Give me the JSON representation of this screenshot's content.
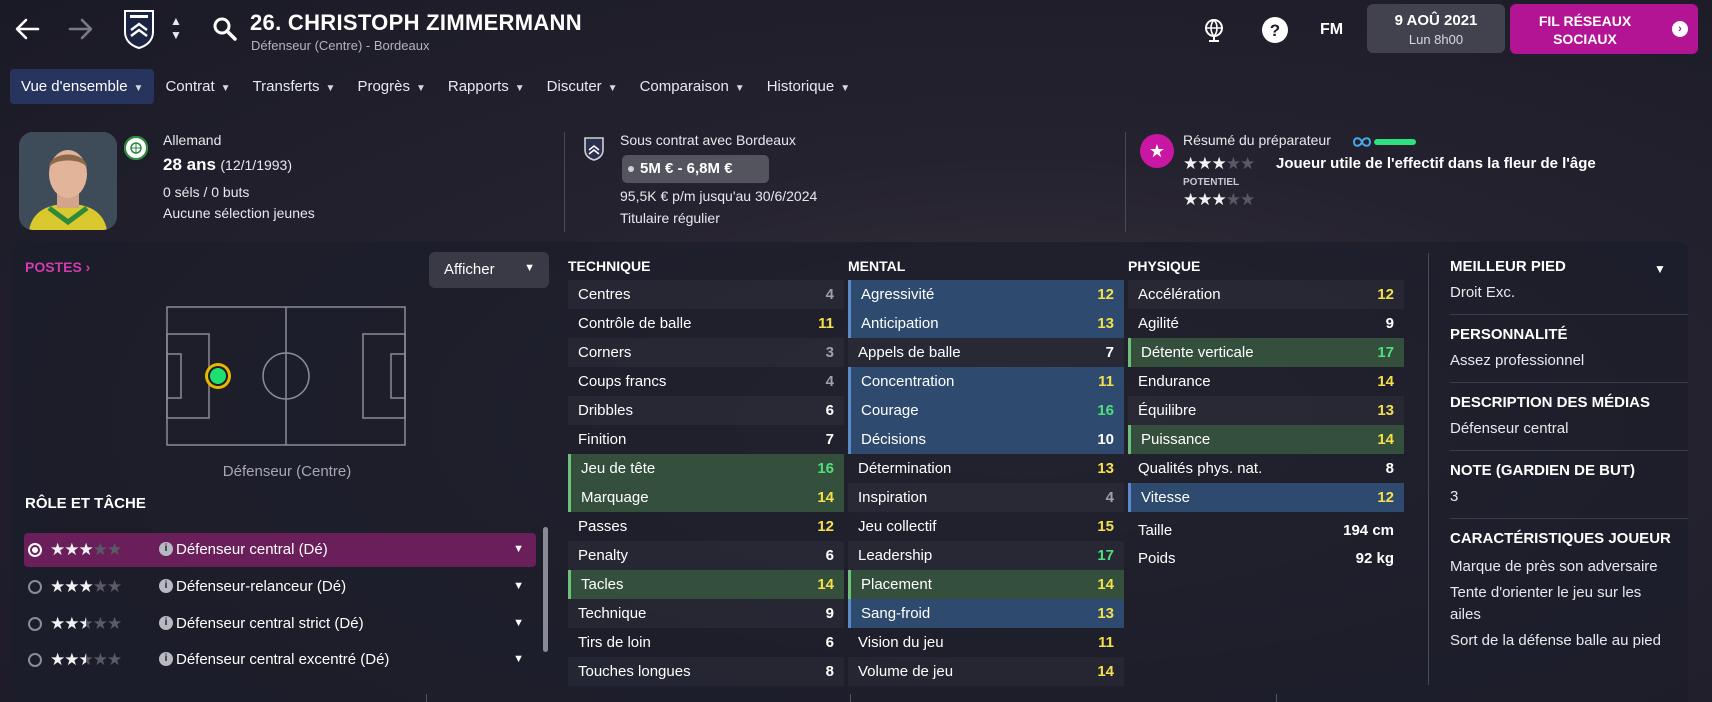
{
  "topbar": {
    "title": "26. CHRISTOPH ZIMMERMANN",
    "subtitle": "Défenseur (Centre) - Bordeaux",
    "fm_logo": "FM",
    "date_line1": "9 AOÛ 2021",
    "date_line2": "Lun 8h00",
    "social_label": "FIL RÉSEAUX SOCIAUX"
  },
  "tabs": [
    {
      "label": "Vue d'ensemble"
    },
    {
      "label": "Contrat"
    },
    {
      "label": "Transferts"
    },
    {
      "label": "Progrès"
    },
    {
      "label": "Rapports"
    },
    {
      "label": "Discuter"
    },
    {
      "label": "Comparaison"
    },
    {
      "label": "Historique"
    }
  ],
  "profile": {
    "nationality": "Allemand",
    "age": "28 ans",
    "dob": "(12/1/1993)",
    "caps": "0 séls / 0 buts",
    "youth": "Aucune sélection jeunes"
  },
  "contract": {
    "club": "Sous contrat avec Bordeaux",
    "value": "5M € - 6,8M €",
    "wage": "95,5K € p/m jusqu'au 30/6/2024",
    "status": "Titulaire régulier"
  },
  "scout": {
    "title": "Résumé du préparateur",
    "current_stars": 3,
    "verdict": "Joueur utile de l'effectif dans la fleur de l'âge",
    "potential_label": "POTENTIEL",
    "potential_stars": 3
  },
  "positions": {
    "title": "POSTES",
    "show_button": "Afficher",
    "label": "Défenseur (Centre)"
  },
  "roles": {
    "title": "RÔLE ET TÂCHE",
    "items": [
      {
        "name": "Défenseur central (Dé)",
        "stars": 3,
        "selected": true
      },
      {
        "name": "Défenseur-relanceur (Dé)",
        "stars": 3,
        "selected": false
      },
      {
        "name": "Défenseur central strict (Dé)",
        "stars": 2.5,
        "selected": false
      },
      {
        "name": "Défenseur central excentré (Dé)",
        "stars": 2.5,
        "selected": false
      }
    ]
  },
  "technique": {
    "title": "TECHNIQUE",
    "items": [
      {
        "name": "Centres",
        "value": "4",
        "color": "grey",
        "hl": "alt"
      },
      {
        "name": "Contrôle de balle",
        "value": "11",
        "color": "yellow",
        "hl": ""
      },
      {
        "name": "Corners",
        "value": "3",
        "color": "grey",
        "hl": "alt"
      },
      {
        "name": "Coups francs",
        "value": "4",
        "color": "grey",
        "hl": ""
      },
      {
        "name": "Dribbles",
        "value": "6",
        "color": "white",
        "hl": "alt"
      },
      {
        "name": "Finition",
        "value": "7",
        "color": "white",
        "hl": ""
      },
      {
        "name": "Jeu de tête",
        "value": "16",
        "color": "green",
        "hl": "green"
      },
      {
        "name": "Marquage",
        "value": "14",
        "color": "yellow",
        "hl": "green"
      },
      {
        "name": "Passes",
        "value": "12",
        "color": "yellow",
        "hl": ""
      },
      {
        "name": "Penalty",
        "value": "6",
        "color": "white",
        "hl": "alt"
      },
      {
        "name": "Tacles",
        "value": "14",
        "color": "yellow",
        "hl": "green"
      },
      {
        "name": "Technique",
        "value": "9",
        "color": "white",
        "hl": "alt"
      },
      {
        "name": "Tirs de loin",
        "value": "6",
        "color": "white",
        "hl": ""
      },
      {
        "name": "Touches longues",
        "value": "8",
        "color": "white",
        "hl": "alt"
      }
    ]
  },
  "mental": {
    "title": "MENTAL",
    "items": [
      {
        "name": "Agressivité",
        "value": "12",
        "color": "yellow",
        "hl": "blue"
      },
      {
        "name": "Anticipation",
        "value": "13",
        "color": "yellow",
        "hl": "blue"
      },
      {
        "name": "Appels de balle",
        "value": "7",
        "color": "white",
        "hl": "alt"
      },
      {
        "name": "Concentration",
        "value": "11",
        "color": "yellow",
        "hl": "blue"
      },
      {
        "name": "Courage",
        "value": "16",
        "color": "green",
        "hl": "blue"
      },
      {
        "name": "Décisions",
        "value": "10",
        "color": "white",
        "hl": "blue"
      },
      {
        "name": "Détermination",
        "value": "13",
        "color": "yellow",
        "hl": ""
      },
      {
        "name": "Inspiration",
        "value": "4",
        "color": "grey",
        "hl": "alt"
      },
      {
        "name": "Jeu collectif",
        "value": "15",
        "color": "yellow",
        "hl": ""
      },
      {
        "name": "Leadership",
        "value": "17",
        "color": "green",
        "hl": "alt"
      },
      {
        "name": "Placement",
        "value": "14",
        "color": "yellow",
        "hl": "green"
      },
      {
        "name": "Sang-froid",
        "value": "13",
        "color": "yellow",
        "hl": "blue"
      },
      {
        "name": "Vision du jeu",
        "value": "11",
        "color": "yellow",
        "hl": ""
      },
      {
        "name": "Volume de jeu",
        "value": "14",
        "color": "yellow",
        "hl": "alt"
      }
    ]
  },
  "physique": {
    "title": "PHYSIQUE",
    "items": [
      {
        "name": "Accélération",
        "value": "12",
        "color": "yellow",
        "hl": "alt"
      },
      {
        "name": "Agilité",
        "value": "9",
        "color": "white",
        "hl": ""
      },
      {
        "name": "Détente verticale",
        "value": "17",
        "color": "green",
        "hl": "green"
      },
      {
        "name": "Endurance",
        "value": "14",
        "color": "yellow",
        "hl": ""
      },
      {
        "name": "Équilibre",
        "value": "13",
        "color": "yellow",
        "hl": "alt"
      },
      {
        "name": "Puissance",
        "value": "14",
        "color": "yellow",
        "hl": "green"
      },
      {
        "name": "Qualités phys. nat.",
        "value": "8",
        "color": "white",
        "hl": ""
      },
      {
        "name": "Vitesse",
        "value": "12",
        "color": "yellow",
        "hl": "blue"
      }
    ],
    "height_label": "Taille",
    "height_value": "194 cm",
    "weight_label": "Poids",
    "weight_value": "92 kg"
  },
  "details": {
    "best_foot_title": "MEILLEUR PIED",
    "best_foot": "Droit Exc.",
    "personality_title": "PERSONNALITÉ",
    "personality": "Assez professionnel",
    "media_title": "DESCRIPTION DES MÉDIAS",
    "media": "Défenseur central",
    "gk_title": "NOTE (GARDIEN DE BUT)",
    "gk": "3",
    "traits_title": "CARACTÉRISTIQUES JOUEUR",
    "traits": [
      "Marque de près son adversaire",
      "Tente d'orienter le jeu sur les",
      "ailes",
      "Sort de la défense balle au pied"
    ]
  },
  "colors": {
    "accent": "#c917a3",
    "tab_active": "#26345e",
    "attr_green": "#4ee07a",
    "attr_yellow": "#f4e04a"
  }
}
